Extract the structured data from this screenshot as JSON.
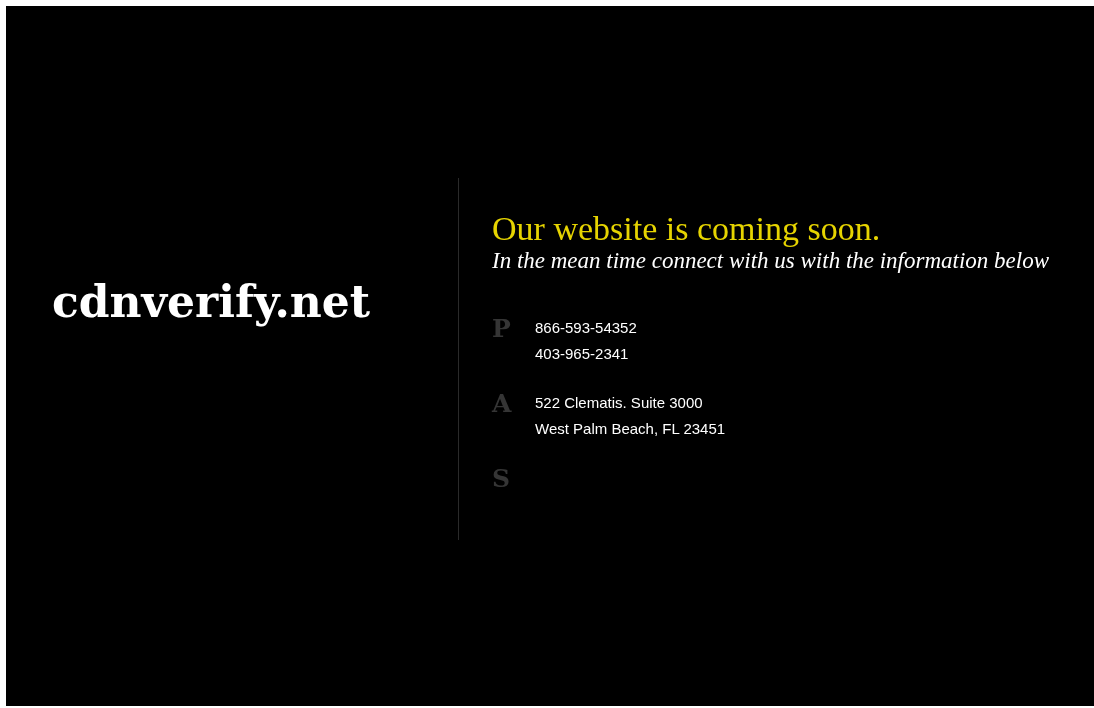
{
  "logo": "cdnverify.net",
  "heading": "Our website is coming soon.",
  "subheading": "In the mean time connect with us with the information below",
  "contacts": [
    {
      "letter": "P",
      "lines": [
        "866-593-54352",
        "403-965-2341"
      ]
    },
    {
      "letter": "A",
      "lines": [
        "522 Clematis. Suite 3000",
        "West Palm Beach, FL 23451"
      ]
    },
    {
      "letter": "S"
    }
  ]
}
